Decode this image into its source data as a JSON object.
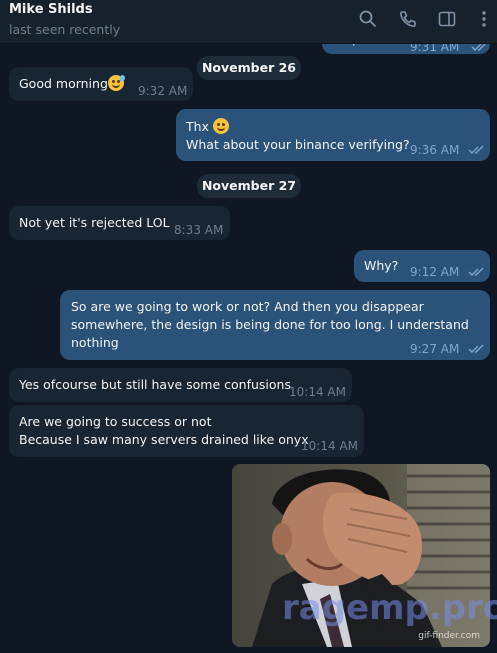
{
  "header": {
    "contact_name": "Mike Shilds",
    "status": "last seen recently",
    "icons": [
      "search-icon",
      "phone-icon",
      "sidebar-toggle-icon",
      "more-icon"
    ]
  },
  "messages": [
    {
      "direction": "out",
      "text": "Yes, sure",
      "time": "9:31 AM",
      "partial": true
    },
    {
      "type": "date",
      "label": "November 26"
    },
    {
      "direction": "in",
      "text": "Good morning",
      "emoji": "sweat-smile-emoji",
      "time": "9:32 AM"
    },
    {
      "direction": "out",
      "line1": "Thx",
      "emoji": "smile-emoji",
      "line2": "What about your binance verifying?",
      "time": "9:36 AM"
    },
    {
      "type": "date",
      "label": "November 27"
    },
    {
      "direction": "in",
      "text": "Not yet it's rejected LOL",
      "time": "8:33 AM"
    },
    {
      "direction": "out",
      "text": "Why?",
      "time": "9:12 AM"
    },
    {
      "direction": "out",
      "line1": "So are we going to work or not? And then you disappear",
      "line2": "somewhere, the design is being done for too long. I understand",
      "line3": "nothing",
      "time": "9:27 AM"
    },
    {
      "direction": "in",
      "text": "Yes ofcourse but still have some confusions",
      "time": "10:14 AM"
    },
    {
      "direction": "in",
      "line1": "Are we going to success or not",
      "line2": "Because I saw many servers drained like onyx",
      "time": "10:14 AM"
    },
    {
      "direction": "out",
      "type": "gif",
      "watermark": "ragemp.pro",
      "source": "gif-finder.com"
    }
  ],
  "colors": {
    "background": "#0e1621",
    "incoming_bubble": "#182533",
    "outgoing_bubble": "#2b5278",
    "read_ticks": "#7da8d3",
    "time_text": "#6d7f8f"
  }
}
